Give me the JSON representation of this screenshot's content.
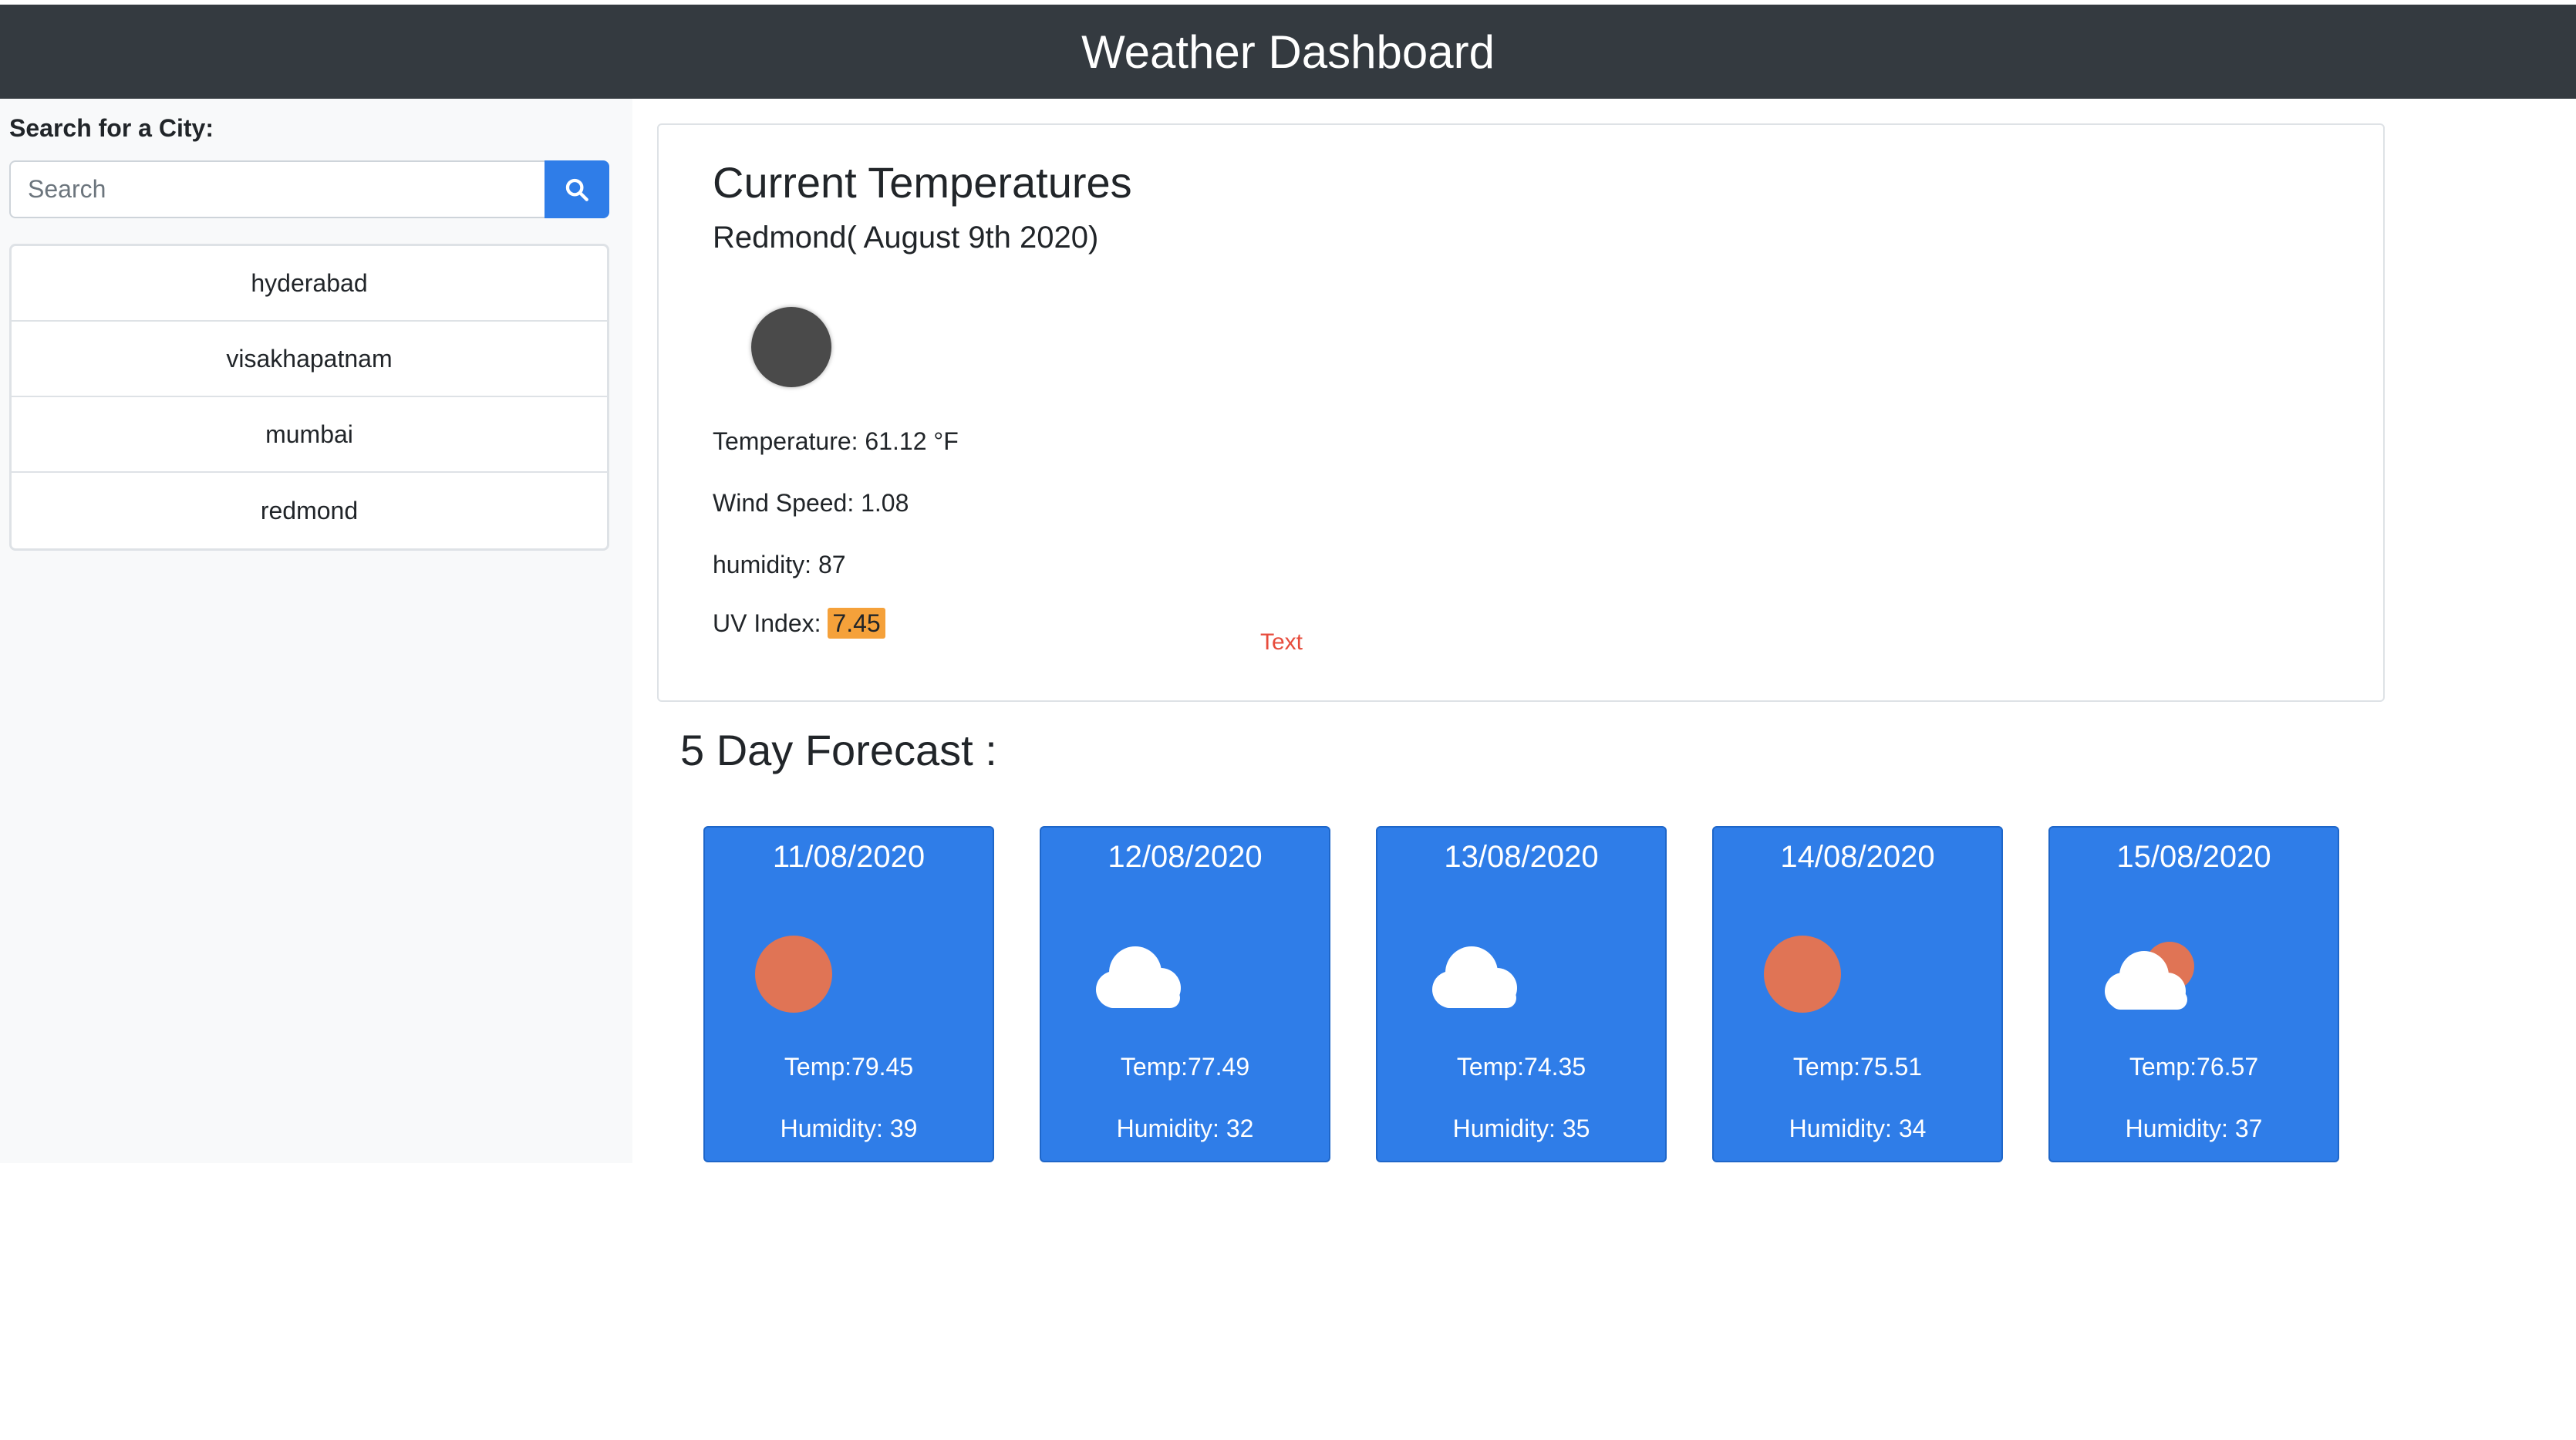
{
  "header": {
    "title": "Weather Dashboard"
  },
  "sidebar": {
    "label": "Search for a City:",
    "search": {
      "placeholder": "Search",
      "value": ""
    },
    "search_icon": "search-icon",
    "cities": [
      "hyderabad",
      "visakhapatnam",
      "mumbai",
      "redmond"
    ]
  },
  "current": {
    "heading": "Current Temperatures",
    "city_date": "Redmond( August 9th 2020)",
    "icon": "night-moon-icon",
    "temperature": "Temperature: 61.12 °F",
    "wind": "Wind Speed: 1.08",
    "humidity": "humidity: 87",
    "uv_label": "UV Index: ",
    "uv_value": "7.45",
    "uv_color": "#f5a13a",
    "stray_text": "Text"
  },
  "forecast": {
    "heading": "5 Day Forecast :",
    "days": [
      {
        "date": "11/08/2020",
        "icon": "sun-icon",
        "temp": "Temp:79.45",
        "humidity": "Humidity: 39"
      },
      {
        "date": "12/08/2020",
        "icon": "cloud-icon",
        "temp": "Temp:77.49",
        "humidity": "Humidity: 32"
      },
      {
        "date": "13/08/2020",
        "icon": "cloud-icon",
        "temp": "Temp:74.35",
        "humidity": "Humidity: 35"
      },
      {
        "date": "14/08/2020",
        "icon": "sun-icon",
        "temp": "Temp:75.51",
        "humidity": "Humidity: 34"
      },
      {
        "date": "15/08/2020",
        "icon": "partly-cloudy-icon",
        "temp": "Temp:76.57",
        "humidity": "Humidity: 37"
      }
    ]
  },
  "colors": {
    "header_bg": "#343a40",
    "accent": "#2f7de8",
    "sun": "#e07455",
    "text_red": "#e74c3c"
  }
}
